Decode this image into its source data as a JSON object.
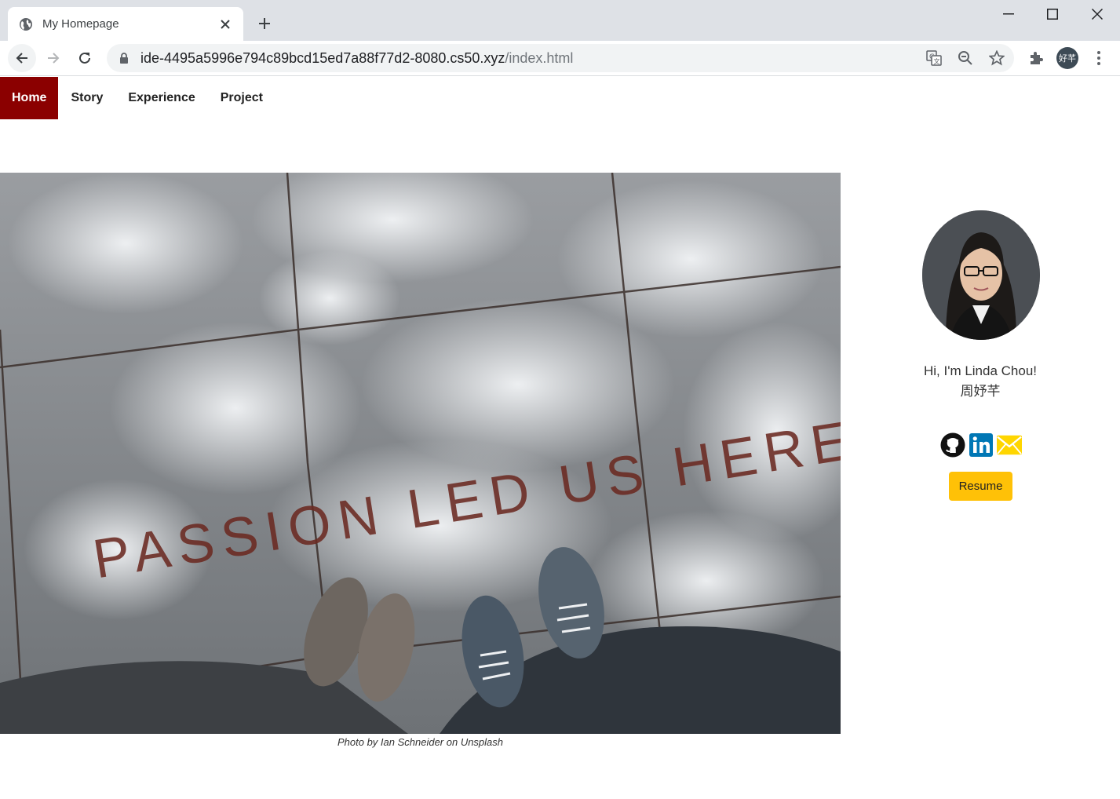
{
  "browser": {
    "tab_title": "My Homepage",
    "url_host": "ide-4495a5996e794c89bcd15ed7a88f77d2-8080.cs50.xyz",
    "url_path": "/index.html",
    "profile_initials": "好芊"
  },
  "nav": {
    "items": [
      {
        "label": "Home",
        "active": true
      },
      {
        "label": "Story",
        "active": false
      },
      {
        "label": "Experience",
        "active": false
      },
      {
        "label": "Project",
        "active": false
      }
    ],
    "active_color": "#8b0000"
  },
  "hero": {
    "photo_text": "PASSION LED US HERE",
    "caption": "Photo by Ian Schneider on Unsplash"
  },
  "profile": {
    "greeting": "Hi, I'm Linda Chou!",
    "chinese_name": "周妤芊",
    "socials": [
      {
        "icon": "github-icon"
      },
      {
        "icon": "linkedin-icon",
        "color": "#0077b5"
      },
      {
        "icon": "mail-icon",
        "color": "#ffd600"
      }
    ],
    "resume_label": "Resume",
    "resume_color": "#ffc107"
  }
}
